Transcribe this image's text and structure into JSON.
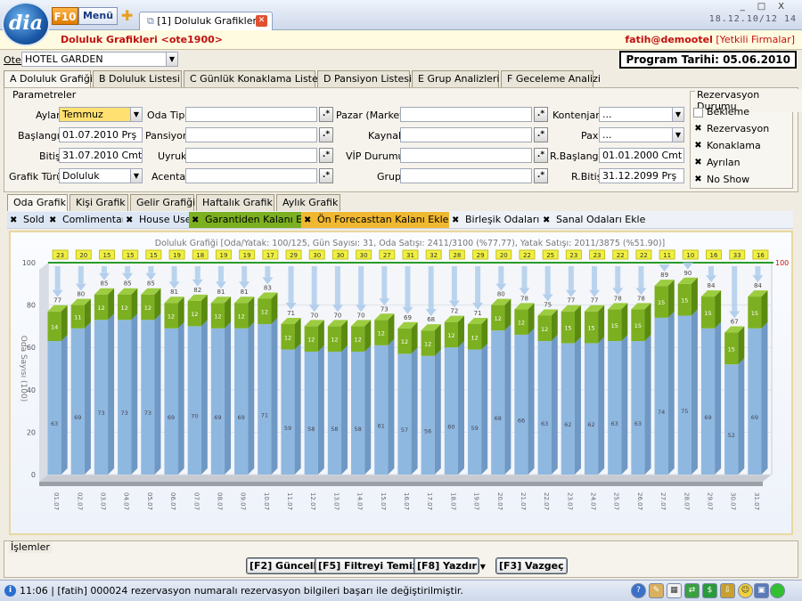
{
  "app": {
    "logo": "dia",
    "f10": "F10",
    "menu": "Menü",
    "tab_title": "[1] Doluluk Grafikleri",
    "clock": "18.12.10/12 14"
  },
  "header": {
    "title": "Doluluk Grafikleri <ote1900>",
    "user": "fatih@demootel",
    "auth": "[Yetkili Firmalar]"
  },
  "otel": {
    "label": "Otel",
    "value": "HOTEL GARDEN"
  },
  "program_date": "Program Tarihi: 05.06.2010",
  "main_tabs": [
    "A Doluluk Grafiği",
    "B Doluluk Listesi",
    "C Günlük Konaklama Listesi",
    "D Pansiyon Listesi",
    "E Grup Analizleri",
    "F Geceleme Analizi"
  ],
  "params": {
    "group_title": "Parametreler",
    "aylar": {
      "label": "Aylar",
      "value": "Temmuz"
    },
    "baslangic": {
      "label": "Başlangıç",
      "value": "01.07.2010 Prş"
    },
    "bitis": {
      "label": "Bitiş",
      "value": "31.07.2010 Cmt"
    },
    "grafik_turu": {
      "label": "Grafik Türü",
      "value": "Doluluk"
    },
    "oda_tipi": {
      "label": "Oda Tipi",
      "value": ""
    },
    "pansiyon": {
      "label": "Pansiyon",
      "value": ""
    },
    "uyruk": {
      "label": "Uyruk",
      "value": ""
    },
    "acenta": {
      "label": "Acenta",
      "value": ""
    },
    "pazar": {
      "label": "Pazar (Market)",
      "value": ""
    },
    "kaynak": {
      "label": "Kaynak",
      "value": ""
    },
    "vip": {
      "label": "VİP Durumu",
      "value": ""
    },
    "grup": {
      "label": "Grup",
      "value": ""
    },
    "kontenjan": {
      "label": "Kontenjan",
      "value": "..."
    },
    "pax": {
      "label": "Pax",
      "value": "..."
    },
    "r_baslangic": {
      "label": "R.Başlangıç",
      "value": "01.01.2000 Cmt"
    },
    "r_bitis": {
      "label": "R.Bitiş",
      "value": "31.12.2099 Prş"
    }
  },
  "rez_durumu": {
    "title": "Rezervasyon Durumu",
    "items": [
      {
        "label": "Bekleme",
        "checked": false
      },
      {
        "label": "Rezervasyon",
        "checked": true
      },
      {
        "label": "Konaklama",
        "checked": true
      },
      {
        "label": "Ayrılan",
        "checked": true
      },
      {
        "label": "No Show",
        "checked": true
      }
    ]
  },
  "sub_tabs": [
    "Oda Grafik",
    "Kişi Grafik",
    "Gelir Grafiği",
    "Haftalık Grafik",
    "Aylık Grafik"
  ],
  "filters": [
    {
      "label": "Sold",
      "color": "#dce6f4"
    },
    {
      "label": "Comlimentary",
      "color": "#dce6f4"
    },
    {
      "label": "House Use",
      "color": "#dce6f4"
    },
    {
      "label": "Garantiden Kalanı Ekle",
      "color": "#7cb020"
    },
    {
      "label": "Ön Forecasttan Kalanı Ekle",
      "color": "#f0b830"
    },
    {
      "label": "Birleşik Odaları Ekle",
      "color": "#eef2f8"
    },
    {
      "label": "Sanal Odaları Ekle",
      "color": "#eef2f8"
    }
  ],
  "chart_data": {
    "type": "bar",
    "title": "Doluluk Grafiği [Oda/Yatak: 100/125, Gün Sayısı: 31, Oda Satışı: 2411/3100 (%77.77), Yatak Satışı: 2011/3875 (%51.90)]",
    "ylabel": "Oda Sayısı (100)",
    "ylim": [
      0,
      100
    ],
    "yticks": [
      0,
      20,
      40,
      60,
      80,
      100
    ],
    "capacity_label": "100",
    "categories": [
      "01.07",
      "02.07",
      "03.07",
      "04.07",
      "05.07",
      "06.07",
      "07.07",
      "08.07",
      "09.07",
      "10.07",
      "11.07",
      "12.07",
      "13.07",
      "14.07",
      "15.07",
      "16.07",
      "17.07",
      "18.07",
      "19.07",
      "20.07",
      "21.07",
      "22.07",
      "23.07",
      "24.07",
      "25.07",
      "26.07",
      "27.07",
      "28.07",
      "29.07",
      "30.07",
      "31.07"
    ],
    "series": [
      {
        "name": "Sold",
        "color": "#8fb8e0",
        "values": [
          63,
          69,
          73,
          73,
          73,
          69,
          70,
          69,
          69,
          71,
          59,
          58,
          58,
          58,
          61,
          57,
          56,
          60,
          59,
          68,
          66,
          63,
          62,
          62,
          63,
          63,
          74,
          75,
          69,
          52,
          69
        ]
      },
      {
        "name": "Garantiden Kalanı Ekle",
        "color": "#7cb020",
        "values": [
          14,
          11,
          12,
          12,
          12,
          12,
          12,
          12,
          12,
          12,
          12,
          12,
          12,
          12,
          12,
          12,
          12,
          12,
          12,
          12,
          12,
          12,
          15,
          15,
          15,
          15,
          15,
          15,
          15,
          15,
          15
        ]
      }
    ],
    "totals": [
      77,
      80,
      85,
      85,
      85,
      81,
      82,
      81,
      81,
      83,
      71,
      70,
      70,
      70,
      73,
      69,
      68,
      72,
      71,
      80,
      78,
      75,
      77,
      77,
      78,
      78,
      89,
      90,
      84,
      67,
      84
    ],
    "available": [
      23,
      20,
      15,
      15,
      15,
      19,
      18,
      19,
      19,
      17,
      29,
      30,
      30,
      30,
      27,
      31,
      32,
      28,
      29,
      20,
      22,
      25,
      23,
      23,
      22,
      22,
      11,
      10,
      16,
      33,
      16
    ]
  },
  "actions": {
    "title": "İşlemler",
    "buttons": [
      "[F2] Güncelle",
      "[F5] Filtreyi Temizle",
      "[F8] Yazdır",
      "[F3] Vazgeç"
    ]
  },
  "status": {
    "text": "11:06 | [fatih] 000024 rezervasyon numaralı rezervasyon bilgileri başarı ile değiştirilmiştir."
  }
}
